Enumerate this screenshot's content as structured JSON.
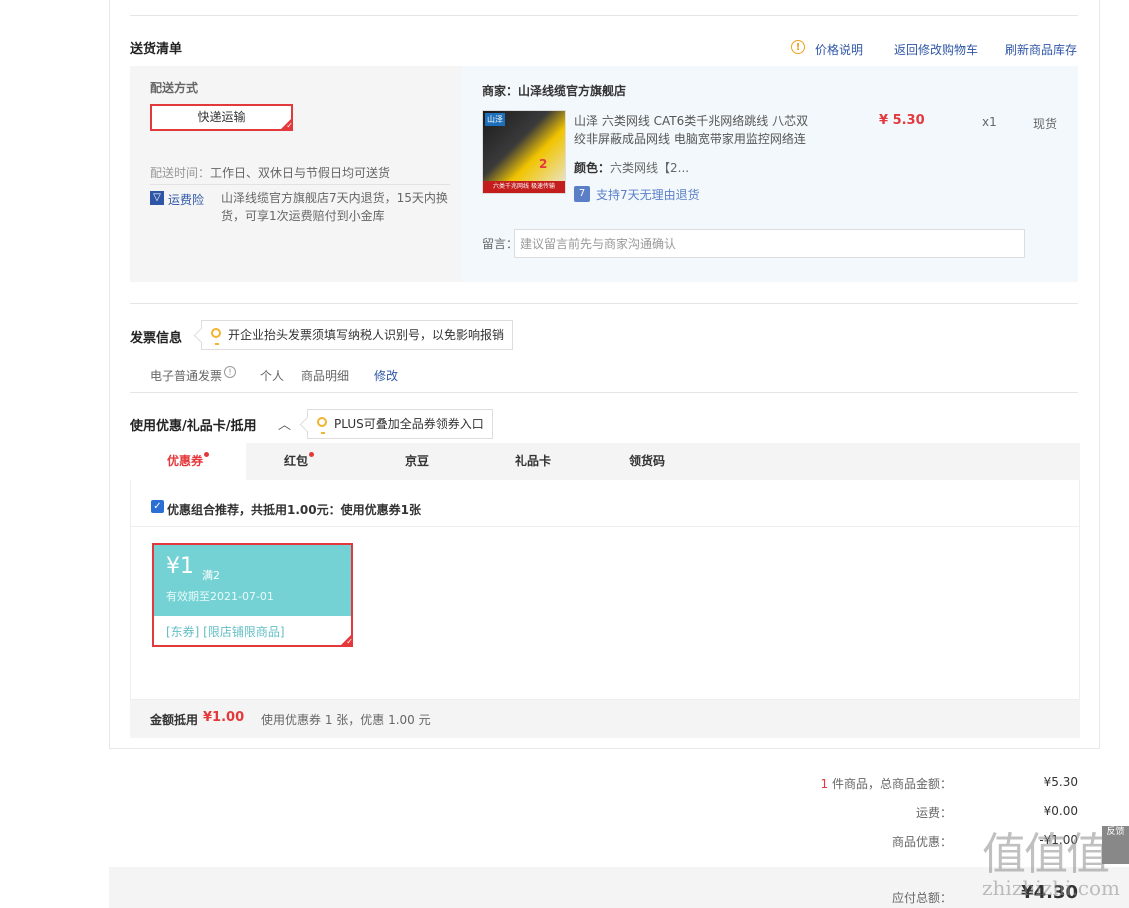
{
  "shipping_list": {
    "title": "送货清单",
    "links": {
      "price_note": "价格说明",
      "back_to_cart": "返回修改购物车",
      "refresh_stock": "刷新商品库存"
    },
    "delivery_method_label": "配送方式",
    "delivery_option": "快递运输",
    "delivery_time_label": "配送时间：",
    "delivery_time_value": "工作日、双休日与节假日均可送货",
    "freight_insurance_label": "运费险",
    "freight_insurance_text_1": "山泽线缆官方旗舰店7天内退货，15天内换",
    "freight_insurance_text_2": "货，可享1次运费赔付到小金库",
    "merchant_label": "商家：山泽线缆官方旗舰店",
    "product": {
      "thumb_tag": "山泽",
      "thumb_badge": "2",
      "thumb_banner": "六类千兆网线 极速传输",
      "name_line1": "山泽 六类网线 CAT6类千兆网络跳线 八芯双",
      "name_line2": "绞非屏蔽成品网线 电脑宽带家用监控网络连",
      "price": "¥ 5.30",
      "qty": "x1",
      "stock": "现货",
      "color_label": "颜色：",
      "color_value": "六类网线【2...",
      "return_policy": "支持7天无理由退货",
      "return_icon_text": "7"
    },
    "remark_label": "留言：",
    "remark_placeholder": "建议留言前先与商家沟通确认"
  },
  "invoice": {
    "title": "发票信息",
    "tip": "开企业抬头发票须填写纳税人识别号，以免影响报销",
    "type": "电子普通发票",
    "holder": "个人",
    "content": "商品明细",
    "modify": "修改"
  },
  "discount": {
    "title": "使用优惠/礼品卡/抵用",
    "tip": "PLUS可叠加全品券领券入口",
    "tabs": [
      "优惠券",
      "红包",
      "京豆",
      "礼品卡",
      "领货码"
    ],
    "combo_text": "优惠组合推荐，共抵用1.00元：使用优惠券1张",
    "coupon": {
      "amount": "¥1",
      "condition": "满2",
      "expiry": "有效期至2021-07-01",
      "tags": "[东券] [限店铺限商品]"
    },
    "amount_label": "金额抵用",
    "amount_value": "¥1.00",
    "amount_detail": "使用优惠券 1 张，优惠 1.00 元"
  },
  "summary": {
    "count": "1",
    "items_label": "件商品，总商品金额：",
    "items_value": "¥5.30",
    "shipping_label": "运费：",
    "shipping_value": "¥0.00",
    "discount_label": "商品优惠：",
    "discount_value": "-¥1.00",
    "total_label": "应付总额：",
    "total_value": "¥4.30"
  },
  "watermark": {
    "logo": "值值值",
    "site": "zhizhizhi.com"
  },
  "colors": {
    "accent_red": "#e4393c",
    "link_blue": "#2f56a6",
    "coupon_teal": "#74d2d4"
  }
}
